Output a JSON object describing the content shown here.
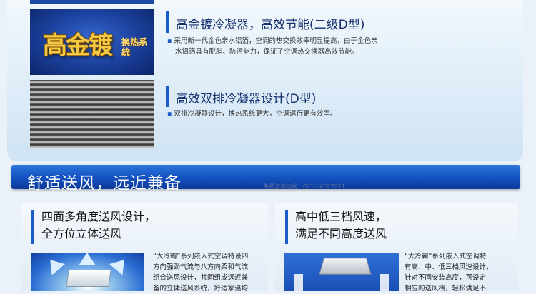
{
  "features": [
    {
      "title": "高金镀冷凝器，高效节能(二级D型)",
      "desc_line1": "采用新一代金色亲水铝箔，空调的热交换效率明显提高，由于金色亲",
      "desc_line2": "水铝箔具有脱脂、防污能力，保证了空调热交换器高效节能。",
      "logo_text": "高金镀",
      "logo_badge": "换热系统"
    },
    {
      "title": "高效双排冷凝器设计(D型)",
      "desc_line1": "双排冷凝器设计，换热系统更大，空调运行更有效率。"
    }
  ],
  "section": {
    "title": "舒适送风，远近兼备",
    "hotline": "免费咨询热线：021-56627211"
  },
  "panels": [
    {
      "title_line1": "四面多角度送风设计，",
      "title_line2": "全方位立体送风",
      "desc": [
        "“大冷霸”系列嵌入式空调特设四",
        "方向强劲气流与八方向柔和气流",
        "组合送风设计，共同组成远近兼",
        "备的立体送风系统，舒适家温均"
      ]
    },
    {
      "title_line1": "高中低三档风速，",
      "title_line2": "满足不同高度送风",
      "desc": [
        "“大冷霸”系列嵌入式空调特",
        "有高、中、低三档风速设计，",
        "针对不同安装高度，可设定",
        "相应的送风档，轻松满足不"
      ]
    }
  ],
  "colors": {
    "accent": "#1b5cc7",
    "section_bar": "#1553c2",
    "title_text": "#15306e"
  }
}
